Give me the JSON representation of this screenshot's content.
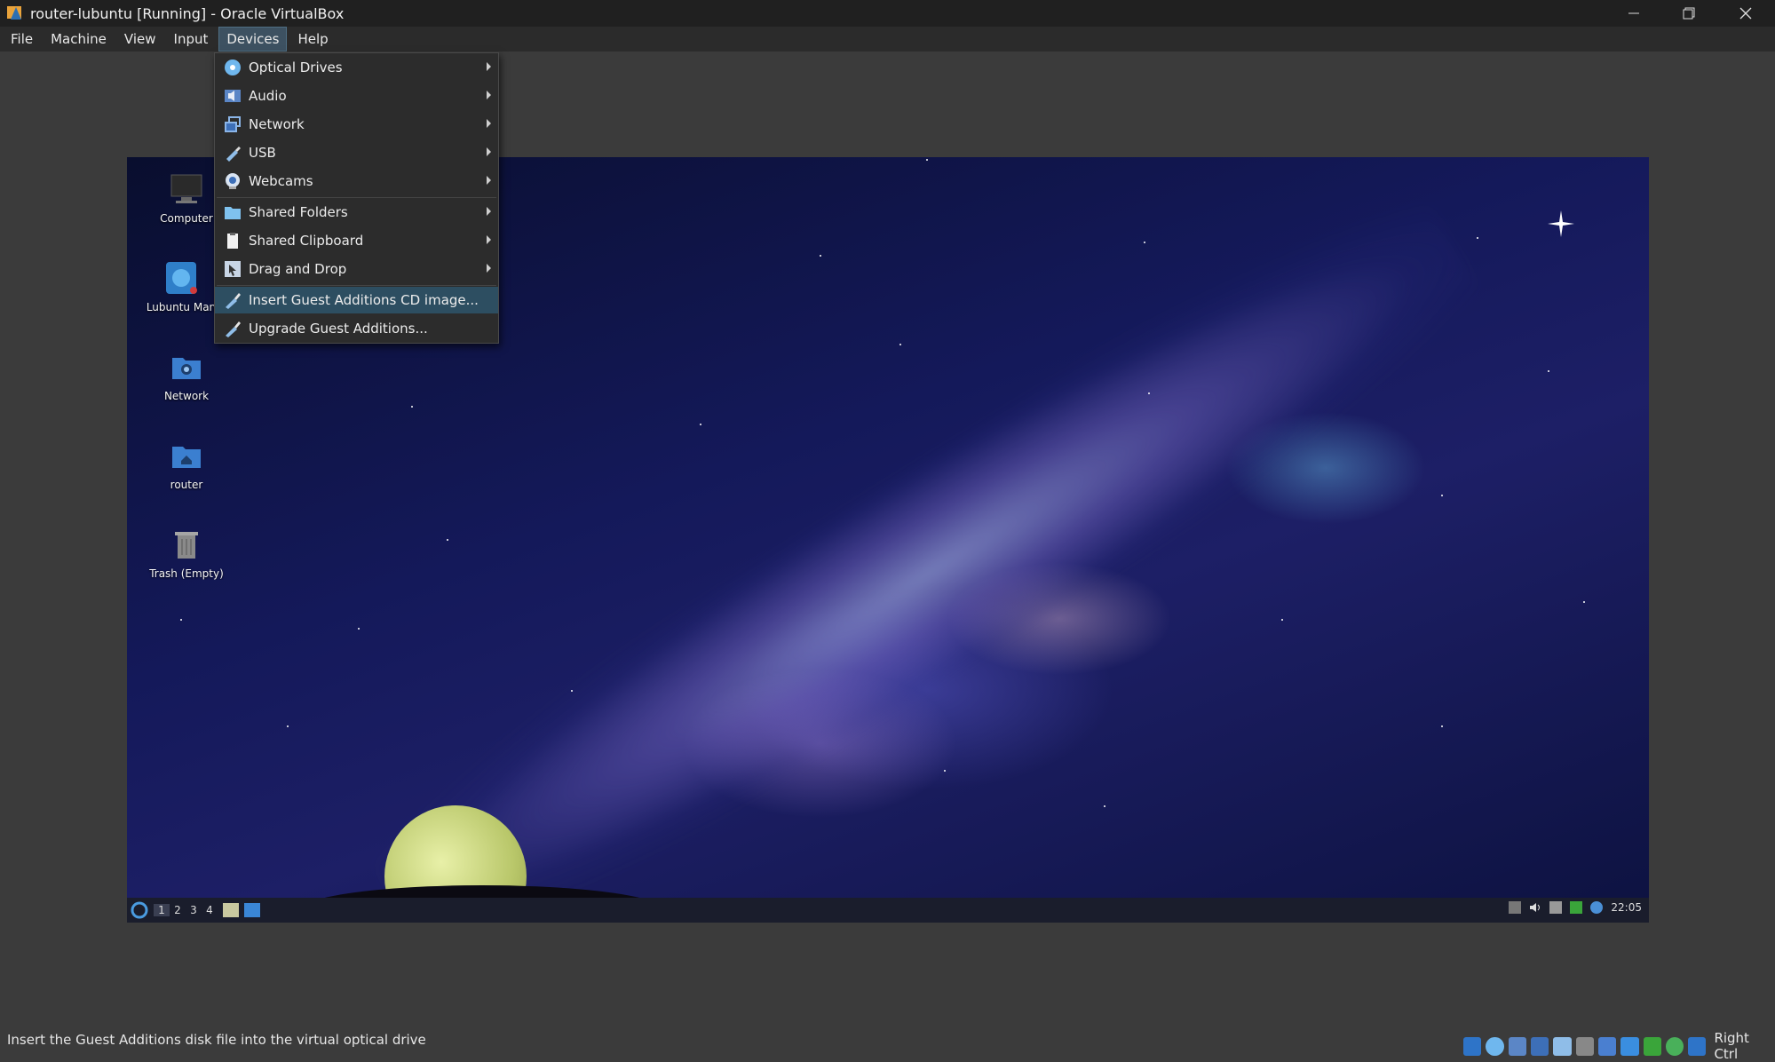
{
  "window": {
    "title": "router-lubuntu [Running] - Oracle VirtualBox"
  },
  "menubar": {
    "items": [
      "File",
      "Machine",
      "View",
      "Input",
      "Devices",
      "Help"
    ],
    "active": "Devices"
  },
  "devices_menu": {
    "items": [
      {
        "label": "Optical Drives",
        "icon": "optical-disc-icon",
        "submenu": true
      },
      {
        "label": "Audio",
        "icon": "audio-icon",
        "submenu": true
      },
      {
        "label": "Network",
        "icon": "network-icon",
        "submenu": true
      },
      {
        "label": "USB",
        "icon": "usb-icon",
        "submenu": true
      },
      {
        "label": "Webcams",
        "icon": "webcam-icon",
        "submenu": true
      },
      {
        "label": "Shared Folders",
        "icon": "shared-folder-icon",
        "submenu": true
      },
      {
        "label": "Shared Clipboard",
        "icon": "clipboard-icon",
        "submenu": true
      },
      {
        "label": "Drag and Drop",
        "icon": "drag-drop-icon",
        "submenu": true
      },
      {
        "label": "Insert Guest Additions CD image...",
        "icon": "guest-additions-icon",
        "submenu": false,
        "highlighted": true
      },
      {
        "label": "Upgrade Guest Additions...",
        "icon": "guest-additions-icon",
        "submenu": false
      }
    ]
  },
  "desktop": {
    "icons": [
      {
        "label": "Computer",
        "icon": "computer-icon"
      },
      {
        "label": "Lubuntu Man",
        "icon": "lubuntu-manual-icon"
      },
      {
        "label": "Network",
        "icon": "network-folder-icon"
      },
      {
        "label": "router",
        "icon": "home-folder-icon"
      },
      {
        "label": "Trash (Empty)",
        "icon": "trash-icon"
      }
    ]
  },
  "guest_taskbar": {
    "workspaces": [
      "1",
      "2",
      "3",
      "4"
    ],
    "active_workspace": "1",
    "clock": "22:05"
  },
  "statusbar": {
    "message": "Insert the Guest Additions disk file into the virtual optical drive",
    "host_key": "Right Ctrl"
  },
  "colors": {
    "menu_highlight": "#2d4e61",
    "window_bg": "#3b3b3b",
    "titlebar_bg": "#202020"
  }
}
